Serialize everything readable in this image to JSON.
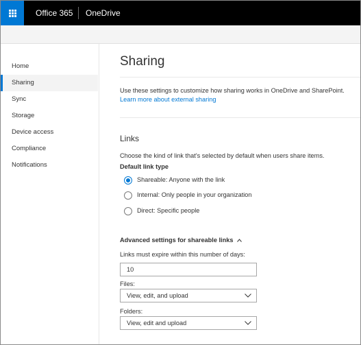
{
  "topbar": {
    "brand": "Office 365",
    "app": "OneDrive",
    "waffle_icon": "app-launcher-icon",
    "accent": "#0078d4"
  },
  "sidebar": {
    "items": [
      {
        "label": "Home",
        "selected": false
      },
      {
        "label": "Sharing",
        "selected": true
      },
      {
        "label": "Sync",
        "selected": false
      },
      {
        "label": "Storage",
        "selected": false
      },
      {
        "label": "Device access",
        "selected": false
      },
      {
        "label": "Compliance",
        "selected": false
      },
      {
        "label": "Notifications",
        "selected": false
      }
    ]
  },
  "main": {
    "title": "Sharing",
    "description": "Use these settings to customize how sharing works in OneDrive and SharePoint.",
    "learn_more": "Learn more about external sharing",
    "links_section": {
      "title": "Links",
      "choose_text": "Choose the kind of link that's selected by default when users share items.",
      "default_link_type_label": "Default link type",
      "options": [
        {
          "label": "Shareable: Anyone with the link",
          "checked": true
        },
        {
          "label": "Internal: Only people in your organization",
          "checked": false
        },
        {
          "label": "Direct: Specific people",
          "checked": false
        }
      ]
    },
    "advanced": {
      "title": "Advanced settings for shareable links",
      "expiry_label": "Links must expire within this number of days:",
      "expiry_value": "10",
      "files_label": "Files:",
      "files_value": "View, edit, and upload",
      "folders_label": "Folders:",
      "folders_value": "View, edit and upload"
    }
  }
}
